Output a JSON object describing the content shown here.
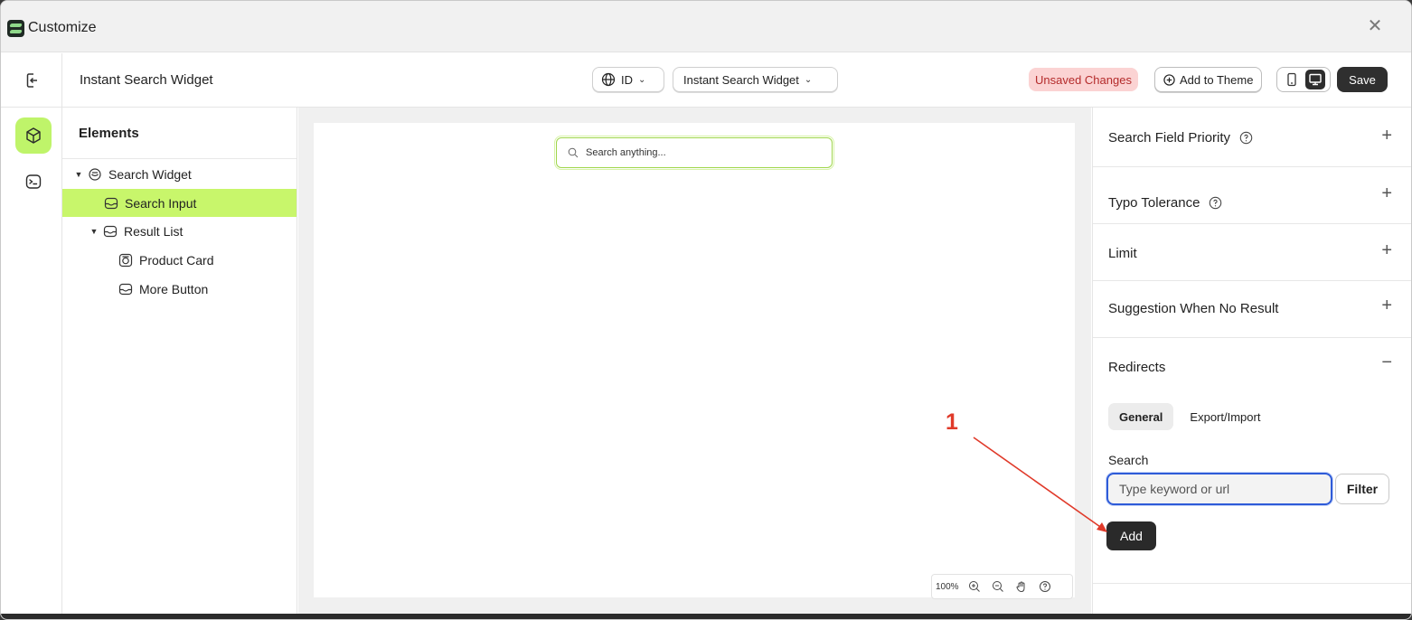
{
  "window": {
    "title": "Customize"
  },
  "toolbar": {
    "page_name": "Instant Search Widget",
    "language": "ID",
    "widget_select": "Instant Search Widget",
    "unsaved_label": "Unsaved Changes",
    "add_to_theme_label": "Add to Theme",
    "save_label": "Save"
  },
  "elements_panel": {
    "title": "Elements",
    "tree": [
      {
        "label": "Search Widget",
        "caret": true,
        "indent": 0,
        "selected": false
      },
      {
        "label": "Search Input",
        "caret": false,
        "indent": 1,
        "selected": true
      },
      {
        "label": "Result List",
        "caret": true,
        "indent": 1,
        "selected": false
      },
      {
        "label": "Product Card",
        "caret": false,
        "indent": 2,
        "selected": false
      },
      {
        "label": "More Button",
        "caret": false,
        "indent": 2,
        "selected": false
      }
    ]
  },
  "canvas": {
    "search_placeholder": "Search anything...",
    "zoom_level": "100%"
  },
  "settings": {
    "sections": [
      {
        "title": "Search Field Priority",
        "help": true,
        "expanded": false
      },
      {
        "title": "Typo Tolerance",
        "help": true,
        "expanded": false
      },
      {
        "title": "Limit",
        "help": false,
        "expanded": false
      },
      {
        "title": "Suggestion When No Result",
        "help": false,
        "expanded": false
      },
      {
        "title": "Redirects",
        "help": false,
        "expanded": true
      }
    ],
    "redirects": {
      "tabs": [
        "General",
        "Export/Import"
      ],
      "active_tab": "General",
      "search_label": "Search",
      "search_placeholder": "Type keyword or url",
      "filter_label": "Filter",
      "add_label": "Add"
    }
  },
  "annotation": {
    "number": "1",
    "color": "#e03a2a"
  },
  "colors": {
    "accent": "#c8f66b",
    "unsaved_bg": "#fbd3d3",
    "unsaved_text": "#b42b2b",
    "focus": "#2e5bd8",
    "dark_button": "#2f2f2f"
  }
}
